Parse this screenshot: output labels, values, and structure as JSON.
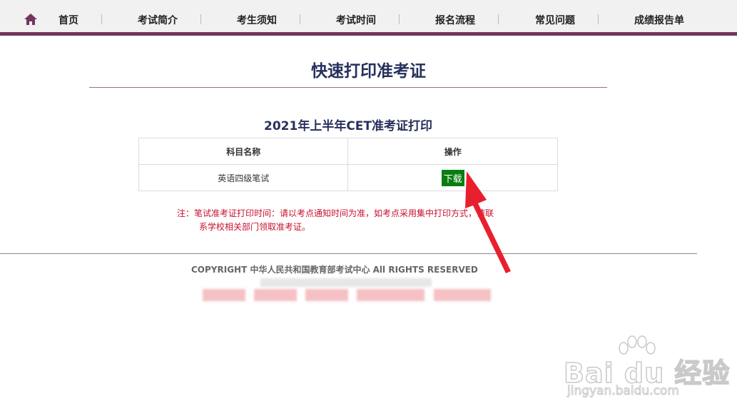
{
  "nav": {
    "items": [
      "首页",
      "考试简介",
      "考生须知",
      "考试时间",
      "报名流程",
      "常见问题",
      "成绩报告单"
    ]
  },
  "page": {
    "title": "快速打印准考证",
    "section_title": "2021年上半年CET准考证打印"
  },
  "table": {
    "headers": [
      "科目名称",
      "操作"
    ],
    "rows": [
      {
        "subject": "英语四级笔试",
        "action": "下载"
      }
    ]
  },
  "note": {
    "line1": "注：笔试准考证打印时间：请以考点通知时间为准，如考点采用集中打印方式，请联",
    "line2": "系学校相关部门领取准考证。"
  },
  "footer": {
    "copyright": "COPYRIGHT 中华人民共和国教育部考试中心 All RIGHTS RESERVED"
  },
  "watermark": {
    "logo": "Bai du 经验",
    "url": "jingyan.baidu.com"
  },
  "colors": {
    "nav_border": "#73355f",
    "title": "#27305c",
    "download_bg": "#0a7d11",
    "note": "#c8102e",
    "arrow": "#e8202e"
  }
}
